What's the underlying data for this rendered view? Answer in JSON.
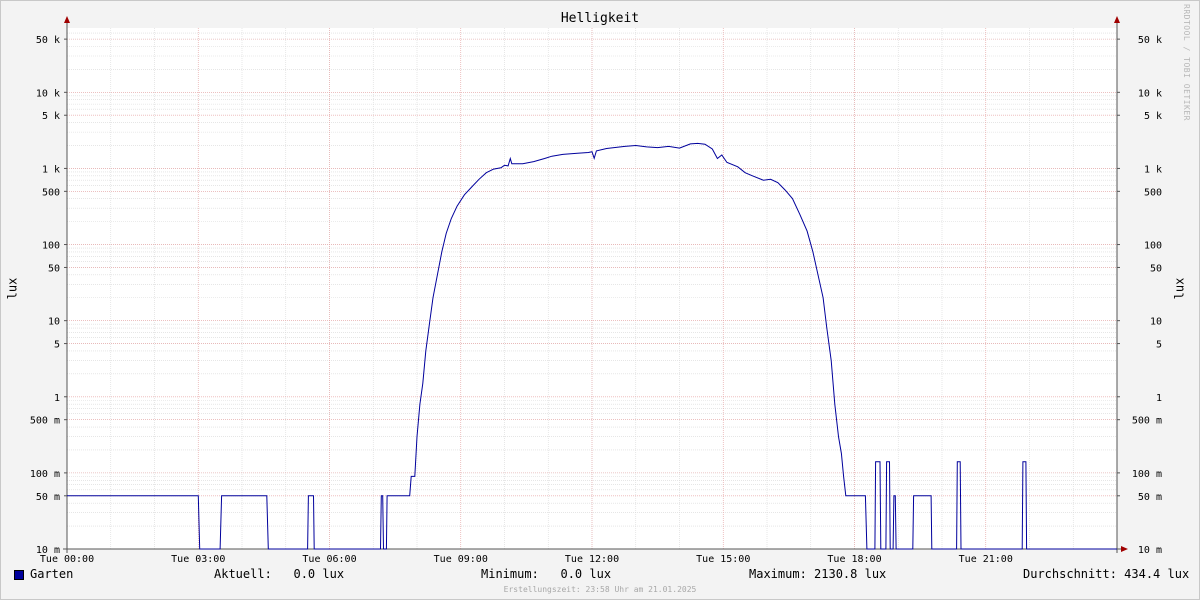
{
  "chart_data": {
    "type": "line",
    "title": "Helligkeit",
    "ylabel": "lux",
    "watermark": "RRDTOOL / TOBI OETIKER",
    "y_scale": "log",
    "ylim": [
      0.01,
      70000
    ],
    "xlim": [
      "00:00",
      "24:00"
    ],
    "grid": true,
    "y_ticks": [
      {
        "value": 0.01,
        "label": "10 m"
      },
      {
        "value": 0.05,
        "label": "50 m"
      },
      {
        "value": 0.1,
        "label": "100 m"
      },
      {
        "value": 0.5,
        "label": "500 m"
      },
      {
        "value": 1,
        "label": "1"
      },
      {
        "value": 5,
        "label": "5"
      },
      {
        "value": 10,
        "label": "10"
      },
      {
        "value": 50,
        "label": "50"
      },
      {
        "value": 100,
        "label": "100"
      },
      {
        "value": 500,
        "label": "500"
      },
      {
        "value": 1000,
        "label": "1 k"
      },
      {
        "value": 5000,
        "label": "5 k"
      },
      {
        "value": 10000,
        "label": "10 k"
      },
      {
        "value": 50000,
        "label": "50 k"
      }
    ],
    "x_ticks": [
      {
        "value": "00:00",
        "label": "Tue 00:00"
      },
      {
        "value": "03:00",
        "label": "Tue 03:00"
      },
      {
        "value": "06:00",
        "label": "Tue 06:00"
      },
      {
        "value": "09:00",
        "label": "Tue 09:00"
      },
      {
        "value": "12:00",
        "label": "Tue 12:00"
      },
      {
        "value": "15:00",
        "label": "Tue 15:00"
      },
      {
        "value": "18:00",
        "label": "Tue 18:00"
      },
      {
        "value": "21:00",
        "label": "Tue 21:00"
      }
    ],
    "series": [
      {
        "name": "Garten",
        "color": "#00009c",
        "points": [
          [
            "00:00",
            0.05
          ],
          [
            "03:00",
            0.05
          ],
          [
            "03:02",
            0.01
          ],
          [
            "03:30",
            0.01
          ],
          [
            "03:32",
            0.05
          ],
          [
            "04:34",
            0.05
          ],
          [
            "04:36",
            0.01
          ],
          [
            "05:30",
            0.01
          ],
          [
            "05:31",
            0.05
          ],
          [
            "05:38",
            0.05
          ],
          [
            "05:39",
            0.01
          ],
          [
            "07:10",
            0.01
          ],
          [
            "07:11",
            0.05
          ],
          [
            "07:13",
            0.05
          ],
          [
            "07:14",
            0.01
          ],
          [
            "07:18",
            0.01
          ],
          [
            "07:19",
            0.05
          ],
          [
            "07:50",
            0.05
          ],
          [
            "07:52",
            0.09
          ],
          [
            "07:57",
            0.09
          ],
          [
            "08:00",
            0.3
          ],
          [
            "08:04",
            0.8
          ],
          [
            "08:08",
            1.5
          ],
          [
            "08:12",
            4
          ],
          [
            "08:17",
            9
          ],
          [
            "08:22",
            20
          ],
          [
            "08:28",
            40
          ],
          [
            "08:34",
            80
          ],
          [
            "08:40",
            140
          ],
          [
            "08:47",
            220
          ],
          [
            "08:55",
            320
          ],
          [
            "09:05",
            450
          ],
          [
            "09:15",
            570
          ],
          [
            "09:25",
            720
          ],
          [
            "09:35",
            880
          ],
          [
            "09:45",
            980
          ],
          [
            "09:55",
            1020
          ],
          [
            "10:00",
            1100
          ],
          [
            "10:05",
            1080
          ],
          [
            "10:08",
            1350
          ],
          [
            "10:10",
            1150
          ],
          [
            "10:25",
            1150
          ],
          [
            "10:40",
            1230
          ],
          [
            "10:55",
            1350
          ],
          [
            "11:05",
            1450
          ],
          [
            "11:20",
            1530
          ],
          [
            "11:40",
            1580
          ],
          [
            "11:55",
            1620
          ],
          [
            "12:00",
            1660
          ],
          [
            "12:03",
            1360
          ],
          [
            "12:06",
            1700
          ],
          [
            "12:20",
            1830
          ],
          [
            "12:45",
            1950
          ],
          [
            "13:00",
            2000
          ],
          [
            "13:15",
            1920
          ],
          [
            "13:30",
            1880
          ],
          [
            "13:45",
            1950
          ],
          [
            "14:00",
            1850
          ],
          [
            "14:15",
            2100
          ],
          [
            "14:25",
            2130.8
          ],
          [
            "14:35",
            2080
          ],
          [
            "14:45",
            1800
          ],
          [
            "14:52",
            1350
          ],
          [
            "14:58",
            1500
          ],
          [
            "15:05",
            1200
          ],
          [
            "15:20",
            1050
          ],
          [
            "15:30",
            880
          ],
          [
            "15:40",
            800
          ],
          [
            "15:55",
            700
          ],
          [
            "16:05",
            720
          ],
          [
            "16:15",
            650
          ],
          [
            "16:25",
            520
          ],
          [
            "16:35",
            400
          ],
          [
            "16:45",
            250
          ],
          [
            "16:55",
            150
          ],
          [
            "17:03",
            80
          ],
          [
            "17:10",
            40
          ],
          [
            "17:17",
            20
          ],
          [
            "17:22",
            8
          ],
          [
            "17:28",
            3
          ],
          [
            "17:33",
            0.8
          ],
          [
            "17:38",
            0.3
          ],
          [
            "17:42",
            0.18
          ],
          [
            "17:45",
            0.09
          ],
          [
            "17:48",
            0.05
          ],
          [
            "18:15",
            0.05
          ],
          [
            "18:17",
            0.01
          ],
          [
            "18:28",
            0.01
          ],
          [
            "18:29",
            0.14
          ],
          [
            "18:35",
            0.14
          ],
          [
            "18:36",
            0.01
          ],
          [
            "18:43",
            0.01
          ],
          [
            "18:44",
            0.14
          ],
          [
            "18:48",
            0.14
          ],
          [
            "18:49",
            0.01
          ],
          [
            "18:53",
            0.01
          ],
          [
            "18:54",
            0.05
          ],
          [
            "18:56",
            0.05
          ],
          [
            "18:57",
            0.01
          ],
          [
            "19:20",
            0.01
          ],
          [
            "19:21",
            0.05
          ],
          [
            "19:45",
            0.05
          ],
          [
            "19:46",
            0.01
          ],
          [
            "20:20",
            0.01
          ],
          [
            "20:21",
            0.14
          ],
          [
            "20:25",
            0.14
          ],
          [
            "20:26",
            0.01
          ],
          [
            "21:50",
            0.01
          ],
          [
            "21:51",
            0.14
          ],
          [
            "21:55",
            0.14
          ],
          [
            "21:56",
            0.01
          ],
          [
            "24:00",
            0.01
          ]
        ]
      }
    ]
  },
  "legend": {
    "series_name": "Garten",
    "current": "Aktuell:   0.0 lux",
    "minimum": "Minimum:   0.0 lux",
    "maximum": "Maximum: 2130.8 lux",
    "average": "Durchschnitt: 434.4 lux"
  },
  "footer": "Erstellungszeit: 23:58 Uhr am 21.01.2025"
}
